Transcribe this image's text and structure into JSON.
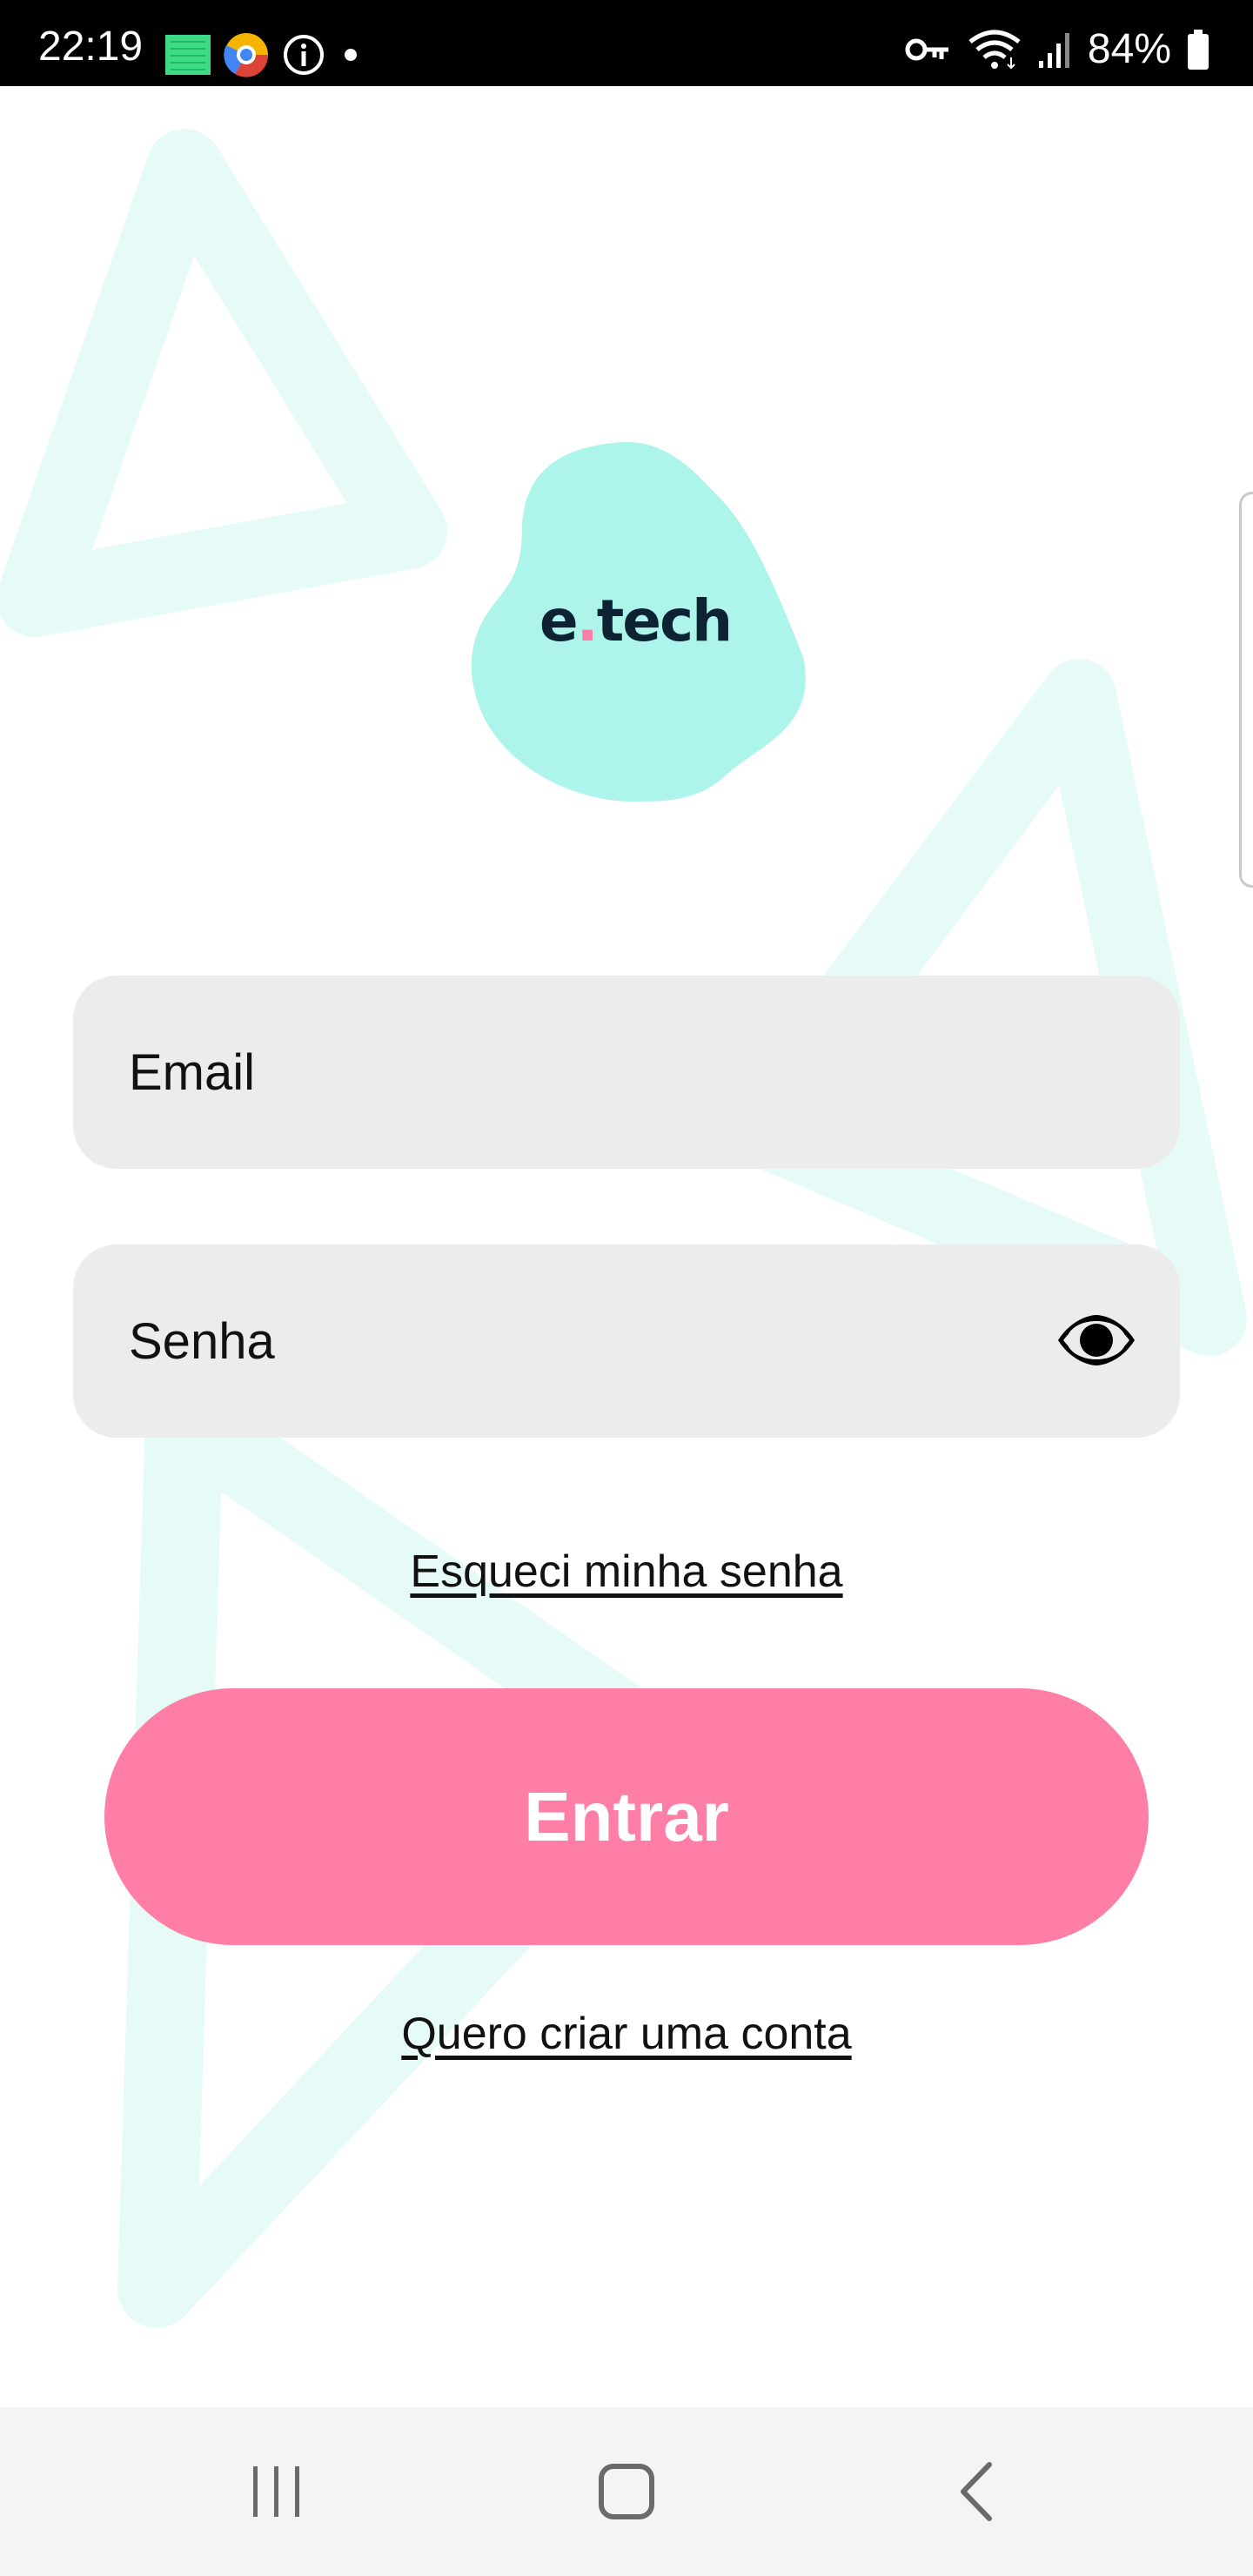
{
  "status_bar": {
    "time": "22:19",
    "battery_percent": "84%",
    "icons_left": [
      "app-square-icon",
      "chrome-like-app-icon",
      "info-icon",
      "notification-dot-icon"
    ],
    "icons_right": [
      "vpn-key-icon",
      "wifi-icon",
      "signal-icon",
      "battery-icon"
    ]
  },
  "logo": {
    "text_before_dot": "e",
    "dot": ".",
    "text_after_dot": "tech"
  },
  "form": {
    "email_placeholder": "Email",
    "email_value": "",
    "password_placeholder": "Senha",
    "password_value": "",
    "password_toggle_icon": "eye-icon"
  },
  "links": {
    "forgot_password": "Esqueci minha senha",
    "create_account": "Quero criar uma conta"
  },
  "actions": {
    "login_label": "Entrar"
  },
  "nav_bar": {
    "buttons": [
      "recents-icon",
      "home-icon",
      "back-icon"
    ]
  },
  "colors": {
    "accent_pink": "#ff7ea6",
    "blob_mint": "#adf5eb",
    "decoration_mint": "#e6fbf7",
    "field_background": "#ececec",
    "logo_text": "#0d2233"
  }
}
